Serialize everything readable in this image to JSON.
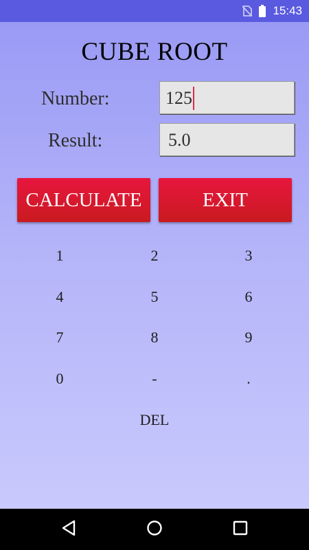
{
  "status_bar": {
    "time": "15:43",
    "icons": [
      "no-sim-icon",
      "battery-icon"
    ],
    "background": "#5a5ae0"
  },
  "app": {
    "title": "CUBE ROOT",
    "number_label": "Number:",
    "number_value": "125",
    "result_label": "Result:",
    "result_value": "5.0",
    "calculate_label": "CALCULATE",
    "exit_label": "EXIT",
    "keypad": [
      [
        "1",
        "2",
        "3"
      ],
      [
        "4",
        "5",
        "6"
      ],
      [
        "7",
        "8",
        "9"
      ],
      [
        "0",
        "-",
        "."
      ]
    ],
    "del_label": "DEL",
    "button_color": "#d91a30"
  },
  "nav_bar": {
    "buttons": [
      "back-icon",
      "home-icon",
      "recents-icon"
    ]
  }
}
